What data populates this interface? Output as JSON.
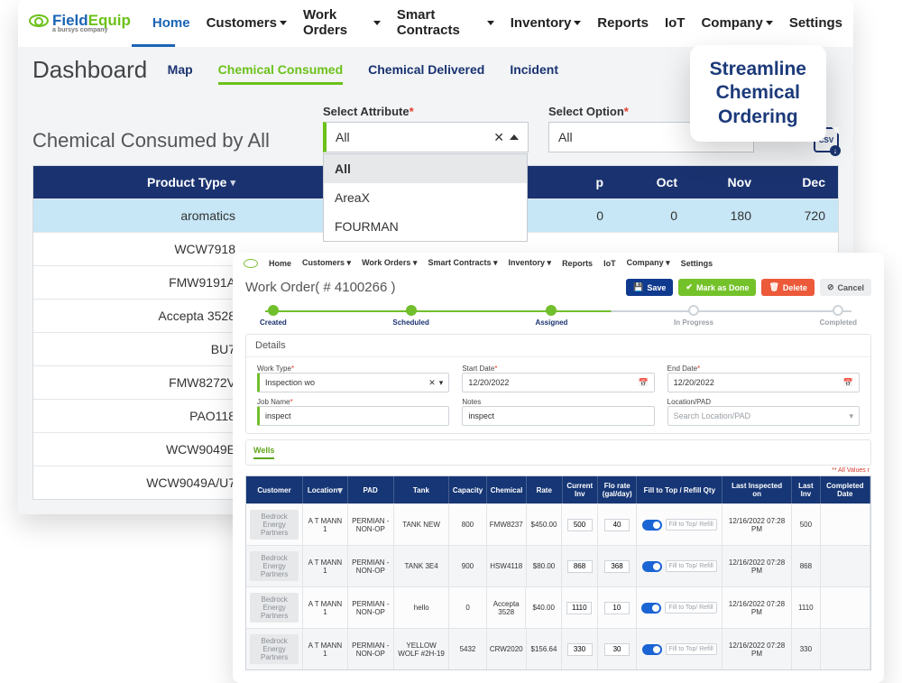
{
  "brand": {
    "field": "Field",
    "equip": "Equip",
    "sub": "a bursys company"
  },
  "nav": {
    "home": "Home",
    "customers": "Customers",
    "work_orders": "Work Orders",
    "smart": "Smart Contracts",
    "inventory": "Inventory",
    "reports": "Reports",
    "iot": "IoT",
    "company": "Company",
    "settings": "Settings"
  },
  "dash": {
    "title": "Dashboard",
    "tabs": {
      "map": "Map",
      "consumed": "Chemical Consumed",
      "delivered": "Chemical Delivered",
      "incident": "Incident"
    },
    "section": "Chemical Consumed by All",
    "attr_label": "Select Attribute",
    "opt_label": "Select Option",
    "attr_value": "All",
    "opt_value": "All",
    "options": [
      "All",
      "AreaX",
      "FOURMAN"
    ],
    "csv": "CSV",
    "header": {
      "product": "Product Type",
      "p": "p",
      "oct": "Oct",
      "nov": "Nov",
      "dec": "Dec"
    },
    "rows": [
      {
        "name": "aromatics",
        "p": "0",
        "oct": "0",
        "nov": "180",
        "dec": "720"
      },
      {
        "name": "WCW7918"
      },
      {
        "name": "FMW9191A"
      },
      {
        "name": "Accepta 3528"
      },
      {
        "name": "BU7"
      },
      {
        "name": "FMW8272V"
      },
      {
        "name": "PAO118"
      },
      {
        "name": "WCW9049E"
      },
      {
        "name": "WCW9049A/U7"
      }
    ]
  },
  "callout": {
    "l1": "Streamline",
    "l2": "Chemical",
    "l3": "Ordering"
  },
  "wo": {
    "title": "Work Order( # 4100266 )",
    "btns": {
      "save": "Save",
      "done": "Mark as Done",
      "delete": "Delete",
      "cancel": "Cancel"
    },
    "steps": [
      "Created",
      "Scheduled",
      "Assigned",
      "In Progress",
      "Completed"
    ],
    "details": "Details",
    "labels": {
      "work_type": "Work Type",
      "start": "Start Date",
      "end": "End Date",
      "job": "Job Name",
      "notes": "Notes",
      "loc": "Location/PAD"
    },
    "values": {
      "work_type": "Inspection wo",
      "start": "12/20/2022",
      "end": "12/20/2022",
      "job": "inspect",
      "notes": "inspect",
      "loc": "Search Location/PAD"
    },
    "wells": "Wells",
    "note": "** All Values r",
    "wh": {
      "cust": "Customer",
      "loc": "Location",
      "pad": "PAD",
      "tank": "Tank",
      "cap": "Capacity",
      "chem": "Chemical",
      "rate": "Rate",
      "cur": "Current Inv",
      "flo": "Flo rate (gal/day)",
      "fill": "Fill to Top / Refill Qty",
      "insp": "Last Inspected on",
      "linv": "Last Inv",
      "comp": "Completed Date"
    },
    "fill_btn": "Fill to Top/ Refill",
    "rows": [
      {
        "cust": "Bedrock Energy Partners",
        "loc": "A T MANN 1",
        "pad": "PERMIAN - NON-OP",
        "tank": "TANK NEW",
        "cap": "800",
        "chem": "FMW8237",
        "rate": "$450.00",
        "cur": "500",
        "flo": "40",
        "insp": "12/16/2022 07:28 PM",
        "linv": "500"
      },
      {
        "cust": "Bedrock Energy Partners",
        "loc": "A T MANN 1",
        "pad": "PERMIAN - NON-OP",
        "tank": "TANK 3E4",
        "cap": "900",
        "chem": "HSW4118",
        "rate": "$80.00",
        "cur": "868",
        "flo": "368",
        "insp": "12/16/2022 07:28 PM",
        "linv": "868"
      },
      {
        "cust": "Bedrock Energy Partners",
        "loc": "A T MANN 1",
        "pad": "PERMIAN - NON-OP",
        "tank": "hello",
        "cap": "0",
        "chem": "Accepta 3528",
        "rate": "$40.00",
        "cur": "1110",
        "flo": "10",
        "insp": "12/16/2022 07:28 PM",
        "linv": "1110"
      },
      {
        "cust": "Bedrock Energy Partners",
        "loc": "A T MANN 1",
        "pad": "PERMIAN - NON-OP",
        "tank": "YELLOW WOLF #2H-19",
        "cap": "5432",
        "chem": "CRW2020",
        "rate": "$156.64",
        "cur": "330",
        "flo": "30",
        "insp": "12/16/2022 07:28 PM",
        "linv": "330"
      }
    ]
  }
}
